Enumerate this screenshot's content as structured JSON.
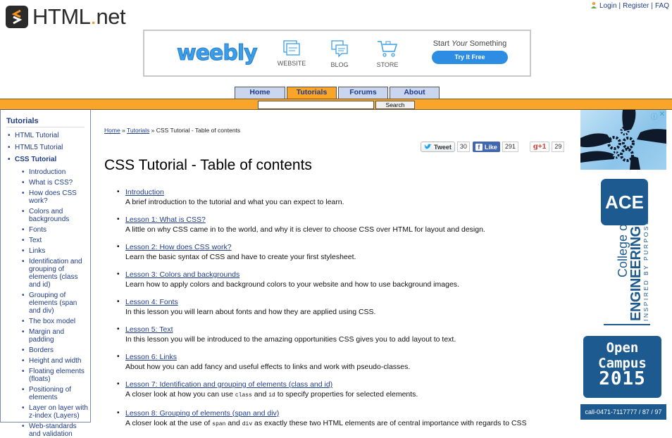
{
  "site": {
    "logo_text_main": "HTML",
    "logo_text_dot": ".",
    "logo_text_tld": "net"
  },
  "toplinks": {
    "login": "Login",
    "register": "Register",
    "faq": "FAQ",
    "separator": "|"
  },
  "banner": {
    "brand": "weebly",
    "items": [
      {
        "label": "WEBSITE",
        "icon": "website-icon"
      },
      {
        "label": "BLOG",
        "icon": "blog-icon"
      },
      {
        "label": "STORE",
        "icon": "cart-icon"
      }
    ],
    "tagline_pre": "Start ",
    "tagline_em": "Your",
    "tagline_post": " Something",
    "cta": "Try It Free"
  },
  "nav": {
    "tabs": [
      {
        "label": "Home",
        "active": false
      },
      {
        "label": "Tutorials",
        "active": true
      },
      {
        "label": "Forums",
        "active": false
      },
      {
        "label": "About",
        "active": false
      }
    ],
    "search_value": "",
    "search_button": "Search"
  },
  "sidebar": {
    "title": "Tutorials",
    "items": [
      {
        "label": "HTML Tutorial"
      },
      {
        "label": "HTML5 Tutorial"
      },
      {
        "label": "CSS Tutorial",
        "current": true
      }
    ],
    "subitems": [
      "Introduction",
      "What is CSS?",
      "How does CSS work?",
      "Colors and backgrounds",
      "Fonts",
      "Text",
      "Links",
      "Identification and grouping of elements (class and id)",
      "Grouping of elements (span and div)",
      "The box model",
      "Margin and padding",
      "Borders",
      "Height and width",
      "Floating elements (floats)",
      "Positioning of elements",
      "Layer on layer with z-index (Layers)",
      "Web-standards and validation"
    ]
  },
  "breadcrumb": {
    "home": "Home",
    "tutorials": "Tutorials",
    "sep": "»",
    "current": "CSS Tutorial - Table of contents"
  },
  "social": {
    "tweet_label": "Tweet",
    "tweet_count": "30",
    "like_label": "Like",
    "like_count": "291",
    "gplus_label": "+1",
    "gplus_count": "29"
  },
  "page": {
    "title": "CSS Tutorial - Table of contents"
  },
  "toc": [
    {
      "link": "Introduction",
      "desc": "A brief introduction to the tutorial and what you can expect to learn."
    },
    {
      "link": "Lesson 1: What is CSS?",
      "desc": "A little on why CSS came in to the world, and why it is clever to choose CSS over HTML for layout and design."
    },
    {
      "link": "Lesson 2: How does CSS work?",
      "desc": "Learn the basic syntax of CSS and have to create your first stylesheet."
    },
    {
      "link": "Lesson 3: Colors and backgrounds",
      "desc": "Learn how to apply colors and background colors to your website and how to use background images."
    },
    {
      "link": "Lesson 4: Fonts",
      "desc": "In this lesson you will learn about fonts and how they are applied using CSS."
    },
    {
      "link": "Lesson 5: Text",
      "desc": "In this lesson you will be introduced to the amazing opportunities CSS gives you to add layout to text."
    },
    {
      "link": "Lesson 6: Links",
      "desc": "About how you can add fancy and useful effects to links and work with pseudo-classes."
    },
    {
      "link": "Lesson 7: Identification and grouping of elements (class and id)",
      "desc_pre": "A closer look at how you can use ",
      "code1": "class",
      "desc_mid": " and ",
      "code2": "id",
      "desc_post": " to specify properties for selected elements."
    },
    {
      "link": "Lesson 8: Grouping of elements (span and div)",
      "desc_pre": "A closer look at the use of ",
      "code1": "span",
      "desc_mid": " and ",
      "code2": "div",
      "desc_post": " as exactly these two HTML elements are of central importance with regards to CSS"
    }
  ],
  "ads": {
    "ace_abbr": "ACE",
    "ace_college_of": "College of",
    "ace_engineering": "ENGINEERING",
    "ace_tagline": "INSPIRED BY PURPOSE",
    "open_line1": "Open",
    "open_line2": "Campus",
    "open_year": "2015",
    "phone": "call-0471-7117777 / 87 / 97",
    "info_icon": "ⓘ",
    "close_icon": "✕"
  },
  "colors": {
    "orange": "#f9a52a",
    "link_blue": "#1f3c88",
    "tab_blue": "#c9d6ee",
    "ace_blue": "#1d5a8f",
    "weebly_blue": "#2d8de3"
  }
}
